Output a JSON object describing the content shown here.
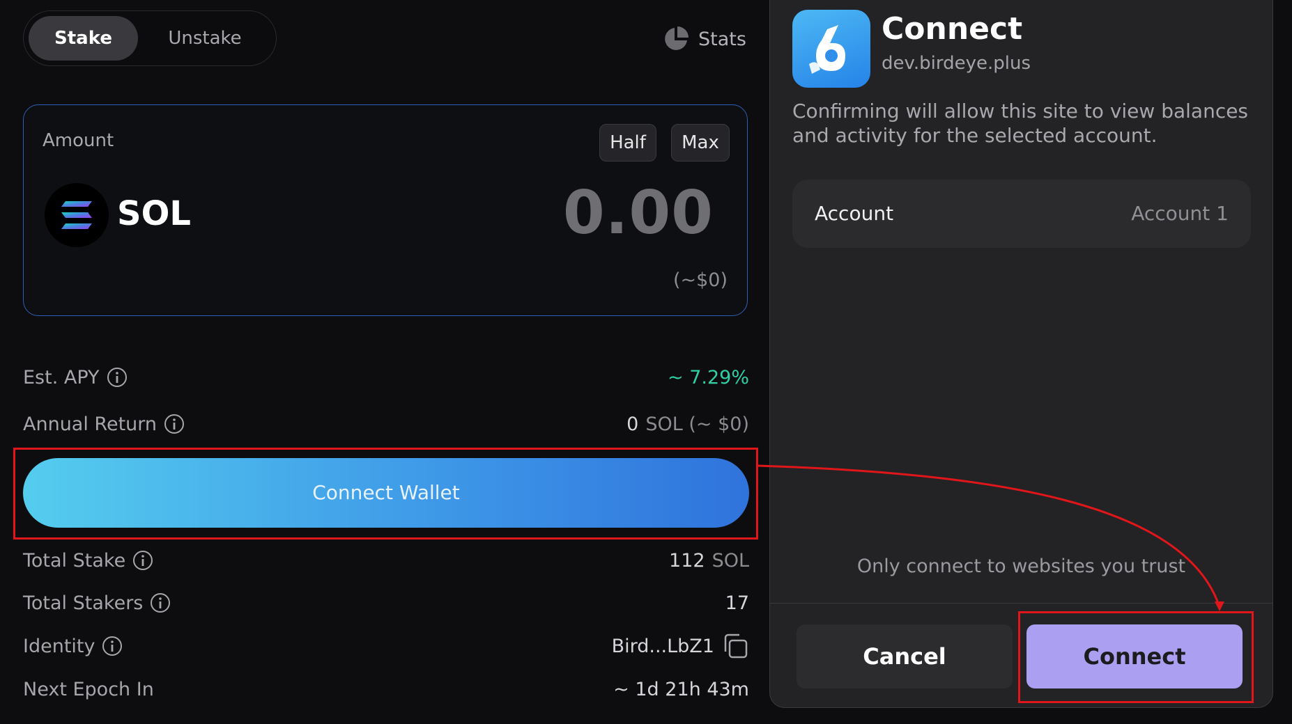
{
  "tabs": {
    "stake": "Stake",
    "unstake": "Unstake"
  },
  "stats": {
    "label": "Stats",
    "icon": "pie-chart-icon"
  },
  "amount": {
    "label": "Amount",
    "half": "Half",
    "max": "Max",
    "token": "SOL",
    "value": "0.00",
    "usd": "(~$0)"
  },
  "details": {
    "apy": {
      "label": "Est. APY",
      "value": "~ 7.29%"
    },
    "annual_return": {
      "label": "Annual Return",
      "value_num": "0",
      "value_unit": "SOL (~ $0)"
    },
    "total_stake": {
      "label": "Total Stake",
      "value_num": "112",
      "value_unit": "SOL"
    },
    "total_stakers": {
      "label": "Total Stakers",
      "value": "17"
    },
    "identity": {
      "label": "Identity",
      "value": "Bird...LbZ1"
    },
    "next_epoch": {
      "label": "Next Epoch In",
      "value": "~ 1d 21h 43m"
    }
  },
  "connect_wallet": "Connect Wallet",
  "modal": {
    "title": "Connect",
    "host": "dev.birdeye.plus",
    "description": "Confirming will allow this site to view balances and activity for the selected account.",
    "account_label": "Account",
    "account_value": "Account 1",
    "trust_note": "Only connect to websites you trust",
    "cancel": "Cancel",
    "connect": "Connect"
  },
  "colors": {
    "accent_apy": "#2fd1a4",
    "connect_button": "#ab9ff2",
    "highlight": "#e0161b",
    "wallet_gradient_start": "#55cdee",
    "wallet_gradient_end": "#2f73dc"
  }
}
